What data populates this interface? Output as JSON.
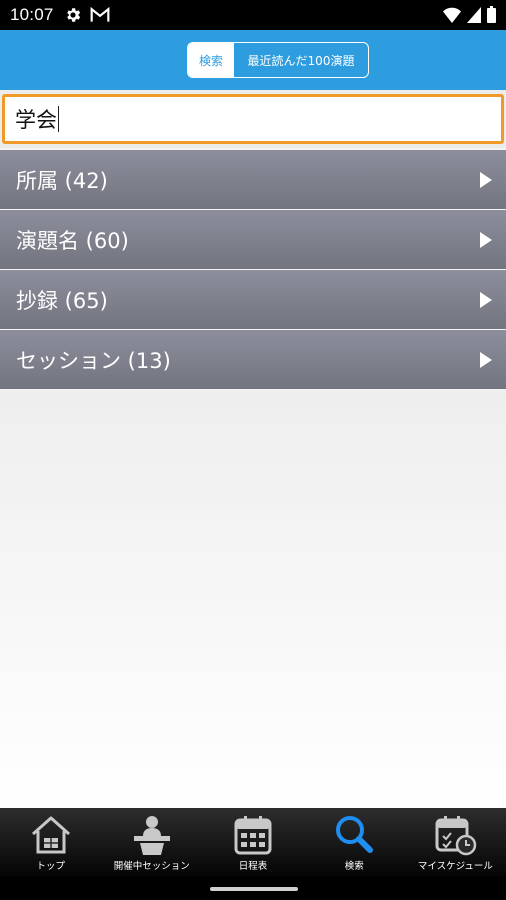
{
  "status_bar": {
    "time": "10:07",
    "icons": [
      "gear-icon",
      "gmail-icon",
      "wifi-icon",
      "signal-icon",
      "battery-icon"
    ]
  },
  "header": {
    "tabs": [
      {
        "label": "検索",
        "active": true
      },
      {
        "label": "最近読んだ100演題",
        "active": false
      }
    ]
  },
  "search": {
    "value": "学会"
  },
  "results": [
    {
      "label": "所属 (42)"
    },
    {
      "label": "演題名 (60)"
    },
    {
      "label": "抄録 (65)"
    },
    {
      "label": "セッション (13)"
    }
  ],
  "tabbar": {
    "items": [
      {
        "label": "トップ",
        "icon": "home-icon"
      },
      {
        "label": "開催中セッション",
        "icon": "podium-icon"
      },
      {
        "label": "日程表",
        "icon": "calendar-icon"
      },
      {
        "label": "検索",
        "icon": "search-icon",
        "active": true
      },
      {
        "label": "マイスケジュール",
        "icon": "calendar-clock-icon"
      }
    ]
  },
  "colors": {
    "header_blue": "#2d9de0",
    "active_tab_blue": "#1f8ef0",
    "search_border": "#f09a2a",
    "list_gray": "#80828e"
  }
}
